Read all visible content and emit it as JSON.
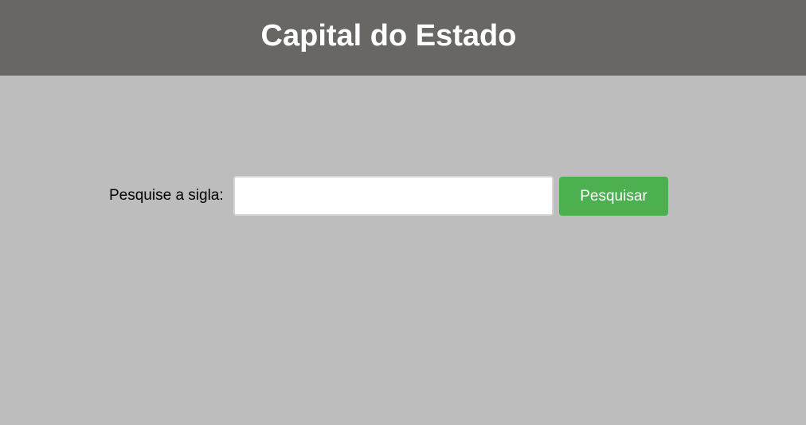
{
  "header": {
    "title": "Capital do Estado"
  },
  "search": {
    "label": "Pesquise a sigla:",
    "input_value": "",
    "placeholder": "",
    "button_label": "Pesquisar"
  },
  "colors": {
    "header_background": "#686763",
    "page_background": "#bdbdbd",
    "button_background": "#4caf50"
  }
}
